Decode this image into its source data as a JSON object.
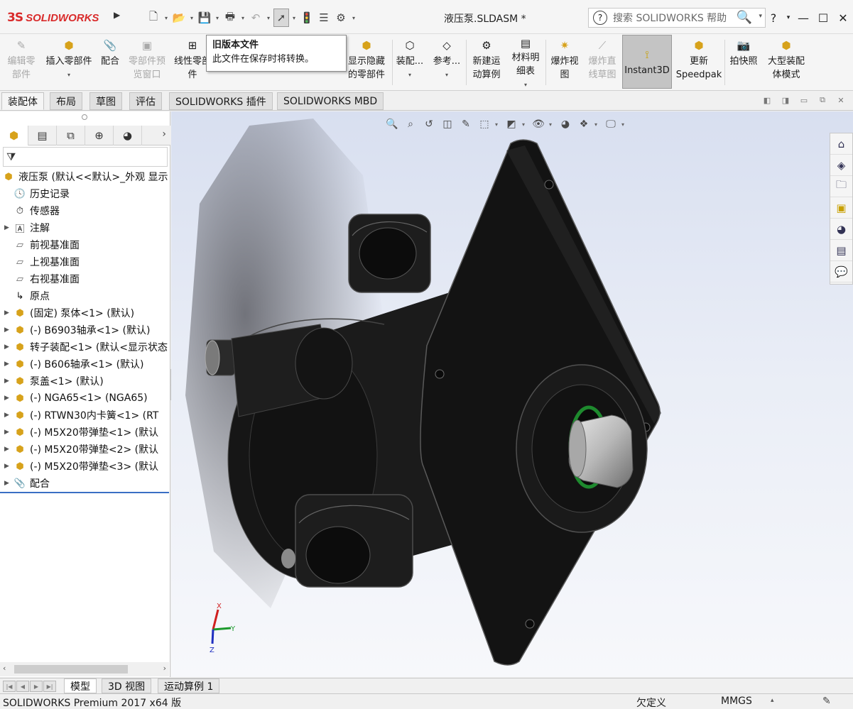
{
  "app": {
    "brand": "SOLIDWORKS",
    "logo_mark": "3S",
    "document_title": "液压泵.SLDASM *"
  },
  "search": {
    "placeholder": "搜索 SOLIDWORKS 帮助"
  },
  "window_controls": {
    "help": "?",
    "minimize": "—",
    "maximize": "☐",
    "close": "✕"
  },
  "commands": [
    {
      "label": "编辑零\n部件",
      "icon": "edit-component-icon",
      "enabled": false
    },
    {
      "label": "插入零部件",
      "icon": "insert-component-icon",
      "enabled": true
    },
    {
      "label": "配合",
      "icon": "mate-icon",
      "enabled": true
    },
    {
      "label": "零部件预\n览窗口",
      "icon": "preview-window-icon",
      "enabled": false
    },
    {
      "label": "线性零部\n件",
      "icon": "linear-pattern-icon",
      "enabled": true
    },
    {
      "label": "显示隐藏\n的零部件",
      "icon": "show-hidden-icon",
      "enabled": true
    },
    {
      "label": "装配...",
      "icon": "assembly-features-icon",
      "enabled": true
    },
    {
      "label": "参考...",
      "icon": "reference-geometry-icon",
      "enabled": true
    },
    {
      "label": "新建运\n动算例",
      "icon": "new-motion-study-icon",
      "enabled": true
    },
    {
      "label": "材料明\n细表",
      "icon": "bom-icon",
      "enabled": true
    },
    {
      "label": "爆炸视\n图",
      "icon": "exploded-view-icon",
      "enabled": true
    },
    {
      "label": "爆炸直\n线草图",
      "icon": "explode-line-sketch-icon",
      "enabled": false
    },
    {
      "label": "Instant3D",
      "icon": "instant3d-icon",
      "enabled": true,
      "active": true
    },
    {
      "label": "更新\nSpeedpak",
      "icon": "speedpak-icon",
      "enabled": true
    },
    {
      "label": "拍快照",
      "icon": "snapshot-icon",
      "enabled": true
    },
    {
      "label": "大型装配\n体模式",
      "icon": "large-assembly-icon",
      "enabled": true
    }
  ],
  "tooltip": {
    "title": "旧版本文件",
    "body": "此文件在保存时将转换。"
  },
  "tabs": [
    "装配体",
    "布局",
    "草图",
    "评估",
    "SOLIDWORKS 插件",
    "SOLIDWORKS MBD"
  ],
  "active_tab": "装配体",
  "feature_tree": {
    "root": "液压泵  (默认<<默认>_外观 显示",
    "items": [
      {
        "label": "历史记录",
        "icon": "history-icon",
        "expandable": false
      },
      {
        "label": "传感器",
        "icon": "sensor-icon",
        "expandable": false
      },
      {
        "label": "注解",
        "icon": "annotations-icon",
        "expandable": true
      },
      {
        "label": "前视基准面",
        "icon": "plane-icon",
        "expandable": false
      },
      {
        "label": "上视基准面",
        "icon": "plane-icon",
        "expandable": false
      },
      {
        "label": "右视基准面",
        "icon": "plane-icon",
        "expandable": false
      },
      {
        "label": "原点",
        "icon": "origin-icon",
        "expandable": false
      },
      {
        "label": "(固定) 泵体<1> (默认)",
        "icon": "part-icon",
        "expandable": true
      },
      {
        "label": "(-) B6903轴承<1> (默认)",
        "icon": "part-icon",
        "expandable": true
      },
      {
        "label": "转子装配<1> (默认<显示状态",
        "icon": "subassembly-icon",
        "expandable": true
      },
      {
        "label": "(-) B606轴承<1> (默认)",
        "icon": "part-icon",
        "expandable": true
      },
      {
        "label": "泵盖<1> (默认)",
        "icon": "part-icon",
        "expandable": true
      },
      {
        "label": "(-) NGA65<1> (NGA65)",
        "icon": "part-icon",
        "expandable": true
      },
      {
        "label": "(-) RTWN30内卡簧<1> (RT",
        "icon": "part-icon",
        "expandable": true
      },
      {
        "label": "(-) M5X20带弹垫<1> (默认",
        "icon": "part-icon",
        "expandable": true
      },
      {
        "label": "(-) M5X20带弹垫<2> (默认",
        "icon": "part-icon",
        "expandable": true
      },
      {
        "label": "(-) M5X20带弹垫<3> (默认",
        "icon": "part-icon",
        "expandable": true
      },
      {
        "label": "配合",
        "icon": "mates-icon",
        "expandable": true
      }
    ]
  },
  "bottom_tabs": [
    "模型",
    "3D 视图",
    "运动算例 1"
  ],
  "active_bottom_tab": "模型",
  "status": {
    "app_version": "SOLIDWORKS Premium 2017 x64 版",
    "definition": "欠定义",
    "units": "MMGS"
  },
  "triad": {
    "x": "X",
    "y": "Y",
    "z": "Z"
  }
}
